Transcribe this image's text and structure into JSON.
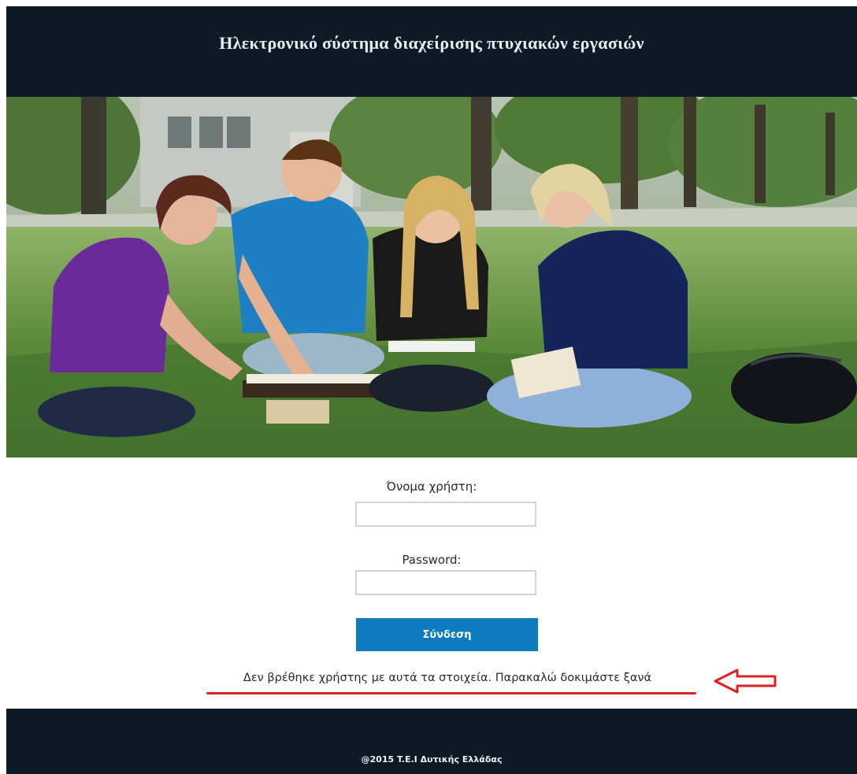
{
  "header": {
    "title": "Ηλεκτρονικό σύστημα διαχείρισης πτυχιακών εργασιών"
  },
  "form": {
    "username_label": "Όνομα χρήστη:",
    "username_value": "",
    "password_label": "Password:",
    "password_value": "",
    "login_button": "Σύνδεση"
  },
  "error": {
    "message": "Δεν βρέθηκε χρήστης με αυτά τα στοιχεία. Παρακαλώ δοκιμάστε ξανά"
  },
  "footer": {
    "copyright": "@2015 T.E.I Δυτικής Ελλάδας"
  },
  "colors": {
    "header_bg": "#0c1b26",
    "button_bg": "#0d7bbd",
    "annotation_red": "#e01f1f"
  },
  "icons": {
    "annotation": "arrow-left-outline-icon"
  }
}
